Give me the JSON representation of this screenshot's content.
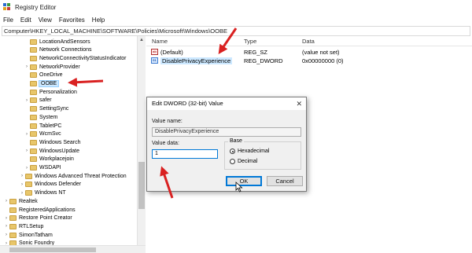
{
  "window": {
    "title": "Registry Editor",
    "accent": "#d92121"
  },
  "menu": [
    "File",
    "Edit",
    "View",
    "Favorites",
    "Help"
  ],
  "address": "Computer\\HKEY_LOCAL_MACHINE\\SOFTWARE\\Policies\\Microsoft\\Windows\\OOBE",
  "tree": {
    "items": [
      {
        "label": "LocationAndSensors",
        "level": 3,
        "expander": ""
      },
      {
        "label": "Network Connections",
        "level": 3,
        "expander": ""
      },
      {
        "label": "NetworkConnectivityStatusIndicator",
        "level": 3,
        "expander": ""
      },
      {
        "label": "NetworkProvider",
        "level": 3,
        "expander": "›"
      },
      {
        "label": "OneDrive",
        "level": 3,
        "expander": ""
      },
      {
        "label": "OOBE",
        "level": 3,
        "expander": "",
        "selected": true
      },
      {
        "label": "Personalization",
        "level": 3,
        "expander": ""
      },
      {
        "label": "safer",
        "level": 3,
        "expander": "›"
      },
      {
        "label": "SettingSync",
        "level": 3,
        "expander": ""
      },
      {
        "label": "System",
        "level": 3,
        "expander": ""
      },
      {
        "label": "TabletPC",
        "level": 3,
        "expander": ""
      },
      {
        "label": "WcmSvc",
        "level": 3,
        "expander": "›"
      },
      {
        "label": "Windows Search",
        "level": 3,
        "expander": ""
      },
      {
        "label": "WindowsUpdate",
        "level": 3,
        "expander": "›"
      },
      {
        "label": "Workplacejoin",
        "level": 3,
        "expander": ""
      },
      {
        "label": "WSDAPI",
        "level": 3,
        "expander": "›"
      },
      {
        "label": "Windows Advanced Threat Protection",
        "level": 2,
        "expander": "›"
      },
      {
        "label": "Windows Defender",
        "level": 2,
        "expander": "›"
      },
      {
        "label": "Windows NT",
        "level": 2,
        "expander": "›"
      },
      {
        "label": "Realtek",
        "level": 1,
        "expander": "›"
      },
      {
        "label": "RegisteredApplications",
        "level": 1,
        "expander": ""
      },
      {
        "label": "Restore Point Creator",
        "level": 1,
        "expander": "›"
      },
      {
        "label": "RTLSetup",
        "level": 1,
        "expander": "›"
      },
      {
        "label": "SimonTatham",
        "level": 1,
        "expander": "›"
      },
      {
        "label": "Sonic Foundry",
        "level": 1,
        "expander": "›"
      }
    ]
  },
  "list": {
    "columns": [
      "Name",
      "Type",
      "Data"
    ],
    "rows": [
      {
        "icon": "ab",
        "name": "(Default)",
        "type": "REG_SZ",
        "data": "(value not set)"
      },
      {
        "icon": "bin",
        "name": "DisablePrivacyExperience",
        "type": "REG_DWORD",
        "data": "0x00000000 (0)",
        "selected": true
      }
    ]
  },
  "dialog": {
    "title": "Edit DWORD (32-bit) Value",
    "close": "✕",
    "value_name_label": "Value name:",
    "value_name": "DisablePrivacyExperience",
    "value_data_label": "Value data:",
    "value_data": "1",
    "base_label": "Base",
    "base_options": [
      "Hexadecimal",
      "Decimal"
    ],
    "base_selected": "Hexadecimal",
    "ok": "OK",
    "cancel": "Cancel"
  }
}
